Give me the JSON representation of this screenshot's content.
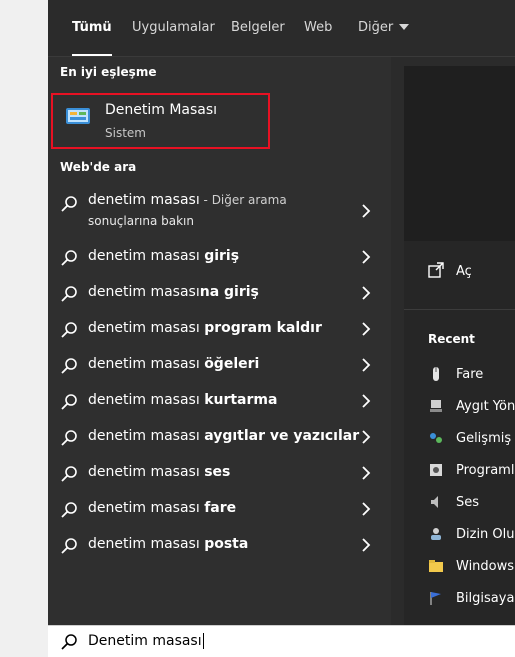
{
  "tabs": [
    {
      "label": "Tümü"
    },
    {
      "label": "Uygulamalar"
    },
    {
      "label": "Belgeler"
    },
    {
      "label": "Web"
    },
    {
      "label": "Diğer"
    }
  ],
  "best_match": {
    "section_title": "En iyi eşleşme",
    "title": "Denetim Masası",
    "subtitle": "Sistem",
    "icon": "control-panel-icon"
  },
  "web": {
    "section_title": "Web'de ara",
    "first": {
      "query": "denetim masası",
      "suffix": " - Diğer arama",
      "line2": "sonuçlarına bakın"
    },
    "suggestions": [
      {
        "base": "denetim masası ",
        "bold": "giriş"
      },
      {
        "base": "denetim masası",
        "bold": "na giriş"
      },
      {
        "base": "denetim masası ",
        "bold": "program kaldır"
      },
      {
        "base": "denetim masası ",
        "bold": "öğeleri"
      },
      {
        "base": "denetim masası ",
        "bold": "kurtarma"
      },
      {
        "base": "denetim masası ",
        "bold": "aygıtlar ve yazıcılar"
      },
      {
        "base": "denetim masası ",
        "bold": "ses"
      },
      {
        "base": "denetim masası ",
        "bold": "fare"
      },
      {
        "base": "denetim masası ",
        "bold": "posta"
      }
    ]
  },
  "right": {
    "open_label": "Aç",
    "recent_title": "Recent",
    "recent": [
      {
        "label": "Fare",
        "icon": "mouse-icon"
      },
      {
        "label": "Aygıt Yöne",
        "icon": "device-manager-icon"
      },
      {
        "label": "Gelişmiş p",
        "icon": "advanced-settings-icon"
      },
      {
        "label": "Programla",
        "icon": "programs-icon"
      },
      {
        "label": "Ses",
        "icon": "speaker-icon"
      },
      {
        "label": "Dizin Oluş",
        "icon": "user-accounts-icon"
      },
      {
        "label": "Windows Y",
        "icon": "folder-icon"
      },
      {
        "label": "Bilgisayar",
        "icon": "flag-icon"
      }
    ]
  },
  "search": {
    "value": "Denetim masası"
  },
  "colors": {
    "highlight_border": "#e81123",
    "panel": "#2f2f2f",
    "background": "#2b2b2b"
  }
}
